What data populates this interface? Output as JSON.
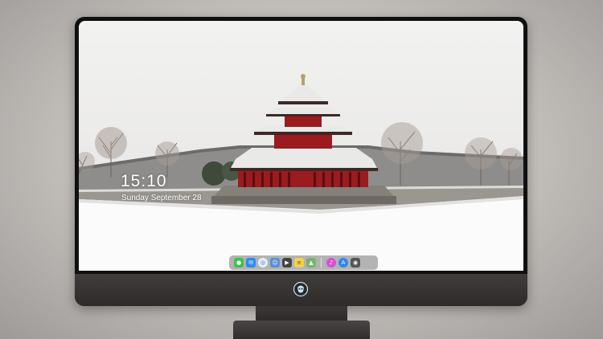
{
  "lock_screen": {
    "time": "15:10",
    "date": "Sunday September 28"
  },
  "dock": {
    "apps": [
      {
        "name": "messages-icon",
        "color": "#3fc34b"
      },
      {
        "name": "mail-icon",
        "color": "#2d8cf0"
      },
      {
        "name": "safari-icon",
        "color": "#e9eef5"
      },
      {
        "name": "finder-icon",
        "color": "#5a8fd8"
      },
      {
        "name": "clapper-icon",
        "color": "#444444"
      },
      {
        "name": "notes-icon",
        "color": "#f4d24a"
      },
      {
        "name": "photos-icon",
        "color": "#7bb36e"
      },
      {
        "name": "itunes-icon",
        "color": "#d84fd2"
      },
      {
        "name": "app-store-icon",
        "color": "#2e86f3"
      },
      {
        "name": "camera-icon",
        "color": "#555555"
      }
    ]
  },
  "colors": {
    "pagoda_red": "#9b1b1f",
    "roof_snow": "#e9e9e7",
    "bezel": "#101010",
    "chin": "#3a3736"
  }
}
